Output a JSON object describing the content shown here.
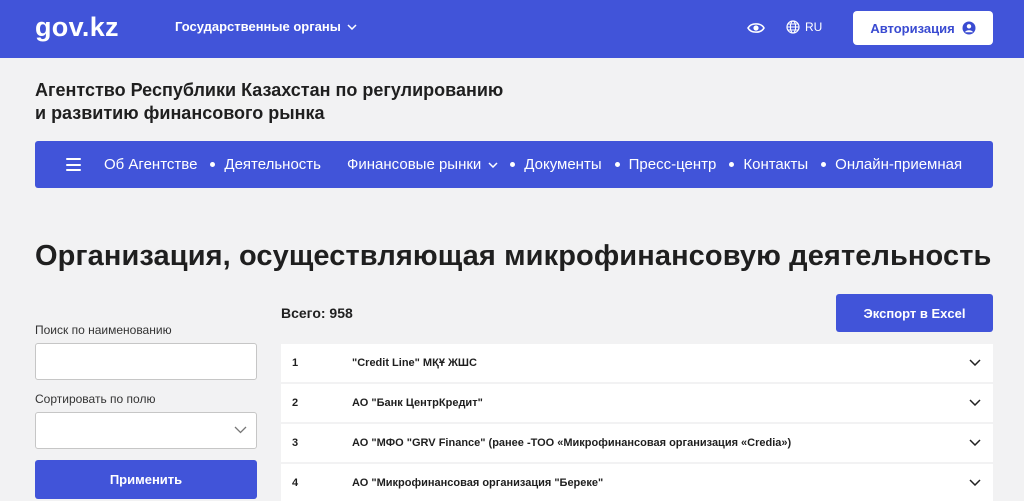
{
  "header": {
    "logo": "gov.kz",
    "gov_menu_label": "Государственные органы",
    "lang": "RU",
    "auth_label": "Авторизация"
  },
  "agency": {
    "title_line1": "Агентство Республики Казахстан по регулированию",
    "title_line2": "и развитию финансового рынка"
  },
  "nav": {
    "items": [
      {
        "label": "Об Агентстве"
      },
      {
        "label": "Деятельность"
      },
      {
        "label": "Финансовые рынки"
      },
      {
        "label": "Документы"
      },
      {
        "label": "Пресс-центр"
      },
      {
        "label": "Контакты"
      },
      {
        "label": "Онлайн-приемная"
      }
    ]
  },
  "page": {
    "title": "Организация, осуществляющая микрофинансовую деятельность"
  },
  "filters": {
    "search_label": "Поиск по наименованию",
    "search_value": "",
    "sort_label": "Сортировать по полю",
    "sort_value": "",
    "apply_label": "Применить"
  },
  "results": {
    "total_label": "Всего: 958",
    "export_label": "Экспорт в Excel",
    "rows": [
      {
        "num": "1",
        "name": "\"Credit Line\" МҚҰ ЖШС"
      },
      {
        "num": "2",
        "name": "АО \"Банк ЦентрКредит\""
      },
      {
        "num": "3",
        "name": "АО \"МФО \"GRV Finance\" (ранее -ТОО «Микрофинансовая организация «Credia»)"
      },
      {
        "num": "4",
        "name": "АО \"Микрофинансовая организация \"Береке\""
      }
    ]
  },
  "colors": {
    "accent": "#4154d9",
    "background": "#f2f2f3"
  }
}
